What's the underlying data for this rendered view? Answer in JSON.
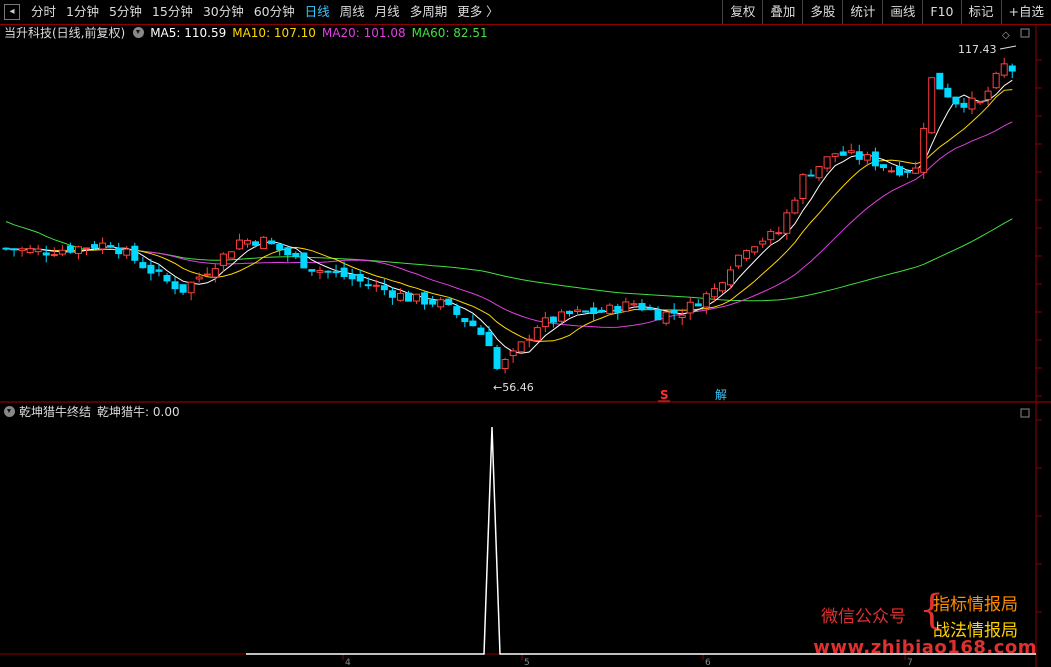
{
  "toolbar": {
    "tabs": [
      {
        "label": "分时",
        "active": false
      },
      {
        "label": "1分钟",
        "active": false
      },
      {
        "label": "5分钟",
        "active": false
      },
      {
        "label": "15分钟",
        "active": false
      },
      {
        "label": "30分钟",
        "active": false
      },
      {
        "label": "60分钟",
        "active": false
      },
      {
        "label": "日线",
        "active": true
      },
      {
        "label": "周线",
        "active": false
      },
      {
        "label": "月线",
        "active": false
      },
      {
        "label": "多周期",
        "active": false
      },
      {
        "label": "更多 〉",
        "active": false
      }
    ],
    "right_buttons": [
      "复权",
      "叠加",
      "多股",
      "统计",
      "画线",
      "F10",
      "标记",
      "+自选"
    ]
  },
  "info": {
    "stock_title": "当升科技(日线,前复权)",
    "ma5": "MA5: 110.59",
    "ma10": "MA10: 107.10",
    "ma20": "MA20: 101.08",
    "ma60": "MA60: 82.51"
  },
  "colors": {
    "up": "#ff4040",
    "down": "#00d8ff",
    "ma5": "#ffffff",
    "ma10": "#ffd700",
    "ma20": "#e040e0",
    "ma60": "#40e040",
    "grid": "#8b0000",
    "active_tab": "#36c8ff"
  },
  "chart_annotations": {
    "high_label": "117.43",
    "low_label": "←56.46",
    "signal_s": "S",
    "signal_jie": "解"
  },
  "sub_indicator": {
    "name": "乾坤猎牛终结",
    "value_text": "乾坤猎牛: 0.00"
  },
  "x_axis_ticks": [
    "4",
    "5",
    "6",
    "7"
  ],
  "watermark": {
    "left": "微信公众号",
    "right_top": "指标情报局",
    "right_bottom": "战法情报局",
    "url": "www.zhibiao168.com"
  },
  "chart_data": {
    "type": "candlestick",
    "price_min_visible": 56.46,
    "price_max_visible": 117.43,
    "indicator_peak_value": 1,
    "indicator_baseline": 0
  }
}
